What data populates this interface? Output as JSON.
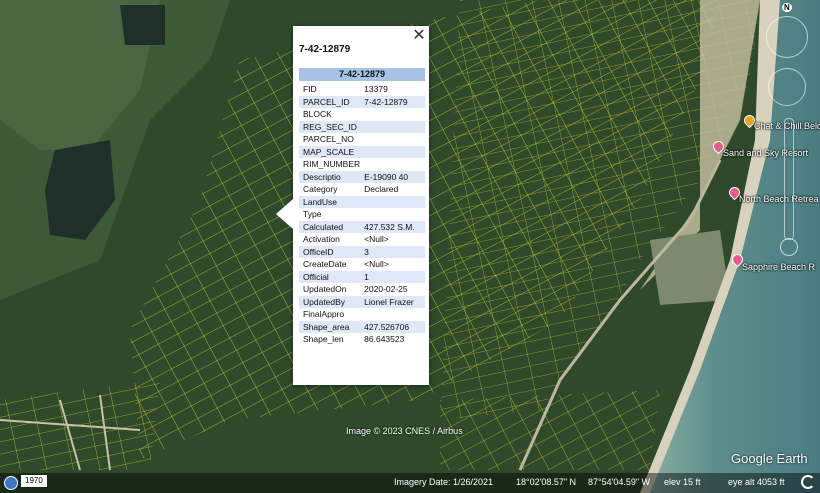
{
  "popup": {
    "title": "7-42-12879",
    "header": "7-42-12879",
    "close_glyph": "✕",
    "attributes": [
      {
        "key": "FID",
        "value": "13379"
      },
      {
        "key": "PARCEL_ID",
        "value": "7-42-12879"
      },
      {
        "key": "BLOCK",
        "value": ""
      },
      {
        "key": "REG_SEC_ID",
        "value": ""
      },
      {
        "key": "PARCEL_NO",
        "value": ""
      },
      {
        "key": "MAP_SCALE",
        "value": ""
      },
      {
        "key": "RIM_NUMBER",
        "value": ""
      },
      {
        "key": "Descriptio",
        "value": "E-19090 40"
      },
      {
        "key": "Category",
        "value": "Declared"
      },
      {
        "key": "LandUse",
        "value": ""
      },
      {
        "key": "Type",
        "value": ""
      },
      {
        "key": "Calculated",
        "value": "427.532 S.M."
      },
      {
        "key": "Activation",
        "value": "<Null>"
      },
      {
        "key": "OfficeID",
        "value": "3"
      },
      {
        "key": "CreateDate",
        "value": "<Null>"
      },
      {
        "key": "Official",
        "value": "1"
      },
      {
        "key": "UpdatedOn",
        "value": "2020-02-25"
      },
      {
        "key": "UpdatedBy",
        "value": "Lionel Frazer"
      },
      {
        "key": "FinalAppro",
        "value": ""
      },
      {
        "key": "Shape_area",
        "value": "427.526706"
      },
      {
        "key": "Shape_len",
        "value": "86.643523"
      }
    ]
  },
  "places": [
    {
      "label": "Chat & Chill Belc",
      "icon": "orange-pin-icon"
    },
    {
      "label": "Sand and Sky Resort",
      "icon": "pink-pin-icon"
    },
    {
      "label": "North Beach Retrea",
      "icon": "pink-pin-icon"
    },
    {
      "label": "Sapphire Beach R",
      "icon": "pink-pin-icon"
    }
  ],
  "attribution": "Image © 2023 CNES / Airbus",
  "logo": "Google Earth",
  "compass_label": "N",
  "status": {
    "year": "1970",
    "imagery_date": "Imagery Date: 1/26/2021",
    "lat": "18°02'08.57\" N",
    "lon": "87°54'04.59\" W",
    "elev": "elev   15 ft",
    "eye_alt": "eye alt  4053 ft"
  },
  "colors": {
    "parcel_lines": "#e8e23a",
    "popup_header": "#a6c3e6",
    "sea": "#5f8f8c"
  }
}
